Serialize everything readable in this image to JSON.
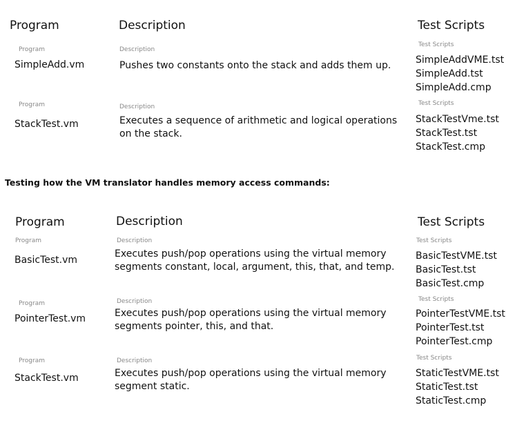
{
  "table1": {
    "headers": {
      "program": "Program",
      "description": "Description",
      "scripts": "Test Scripts"
    },
    "rows": [
      {
        "program_label": "Program",
        "description_label": "Description",
        "scripts_label": "Test Scripts",
        "program": "SimpleAdd.vm",
        "description": "Pushes two constants onto the stack and adds them up.",
        "scripts": [
          "SimpleAddVME.tst",
          "SimpleAdd.tst",
          "SimpleAdd.cmp"
        ]
      },
      {
        "program_label": "Program",
        "description_label": "Description",
        "scripts_label": "Test Scripts",
        "program": "StackTest.vm",
        "description": "Executes a sequence of arithmetic and logical operations on the stack.",
        "scripts": [
          "StackTestVme.tst",
          "StackTest.tst",
          "StackTest.cmp"
        ]
      }
    ]
  },
  "section_heading": "Testing how the VM translator handles memory access commands:",
  "table2": {
    "headers": {
      "program": "Program",
      "description": "Description",
      "scripts": "Test Scripts"
    },
    "rows": [
      {
        "program_label": "Program",
        "description_label": "Description",
        "scripts_label": "Test Scripts",
        "program": "BasicTest.vm",
        "description": "Executes push/pop operations using the virtual memory segments constant, local, argument, this, that, and temp.",
        "scripts": [
          "BasicTestVME.tst",
          "BasicTest.tst",
          "BasicTest.cmp"
        ]
      },
      {
        "program_label": "Program",
        "description_label": "Description",
        "scripts_label": "Test Scripts",
        "program": "PointerTest.vm",
        "description": "Executes push/pop operations using the virtual memory segments pointer, this, and that.",
        "scripts": [
          "PointerTestVME.tst",
          "PointerTest.tst",
          "PointerTest.cmp"
        ]
      },
      {
        "program_label": "Program",
        "description_label": "Description",
        "scripts_label": "Test Scripts",
        "program": "StackTest.vm",
        "description": "Executes push/pop operations using the virtual memory segment static.",
        "scripts": [
          "StaticTestVME.tst",
          "StaticTest.tst",
          "StaticTest.cmp"
        ]
      }
    ]
  }
}
